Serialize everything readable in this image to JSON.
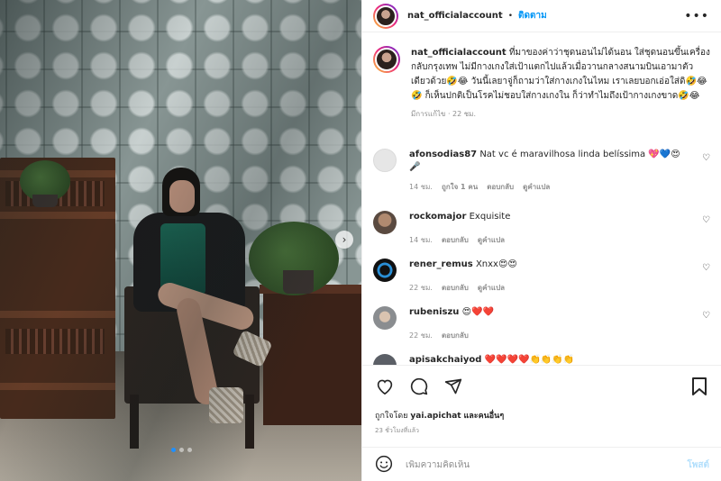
{
  "post": {
    "username": "nat_officialaccount",
    "separator": "•",
    "follow_label": "ติดตาม",
    "more_label": "•••",
    "carousel": {
      "slide_count": 3,
      "active_slide": 1,
      "next_arrow": "›"
    }
  },
  "caption": {
    "username": "nat_officialaccount",
    "text": "ที่มาของค่าว่าชุดนอนไม่ได้นอน ใส่ชุดนอนขึ้นเครื่องกลับกรุงเทพ ไม่มีกางเกงใส่เป้าแตกไปแล้วเมื่อวานกลางสนามบินเอามาตัวเดียวด้วย🤣😂 วันนี้เลยาจู่ก็ถามว่าใส่กางเกงในไหม เราเลยบอกเอ่อใส่ดิ🤣😂🤣 ก็เห็นปกติเป็นโรคไม่ชอบใส่กางเกงใน ก็ว่าทำไมถึงเป้ากางเกงขาด🤣😂",
    "meta": "มีการแก้ไข · 22 ชม."
  },
  "comments": [
    {
      "username": "afonsodias87",
      "text": "Nat vc é maravilhosa linda belíssima 💖💙😍🎤",
      "time": "14 ชม.",
      "likes": "ถูกใจ 1 คน",
      "reply": "ตอบกลับ",
      "translate": "ดูคำแปล"
    },
    {
      "username": "rockomajor",
      "text": "Exquisite",
      "time": "14 ชม.",
      "reply": "ตอบกลับ",
      "translate": "ดูคำแปล"
    },
    {
      "username": "rener_remus",
      "text": "Xnxx😍😍",
      "time": "22 ชม.",
      "reply": "ตอบกลับ",
      "translate": "ดูคำแปล"
    },
    {
      "username": "rubeniszu",
      "text": "😍❤️❤️",
      "time": "22 ชม.",
      "reply": "ตอบกลับ"
    },
    {
      "username": "apisakchaiyod",
      "text": "❤️❤️❤️❤️👏👏👏👏"
    }
  ],
  "actions": {
    "liked_by_prefix": "ถูกใจโดย",
    "liked_by_user": "yai.apichat",
    "liked_by_suffix": "และคนอื่นๆ",
    "time_ago": "23 ชั่วโมงที่แล้ว"
  },
  "add_comment": {
    "placeholder": "เพิ่มความคิดเห็น",
    "post_label": "โพสต์"
  },
  "colors": {
    "accent": "#0095f6",
    "post_disabled": "#b2dffc",
    "muted": "#8e8e8e"
  }
}
